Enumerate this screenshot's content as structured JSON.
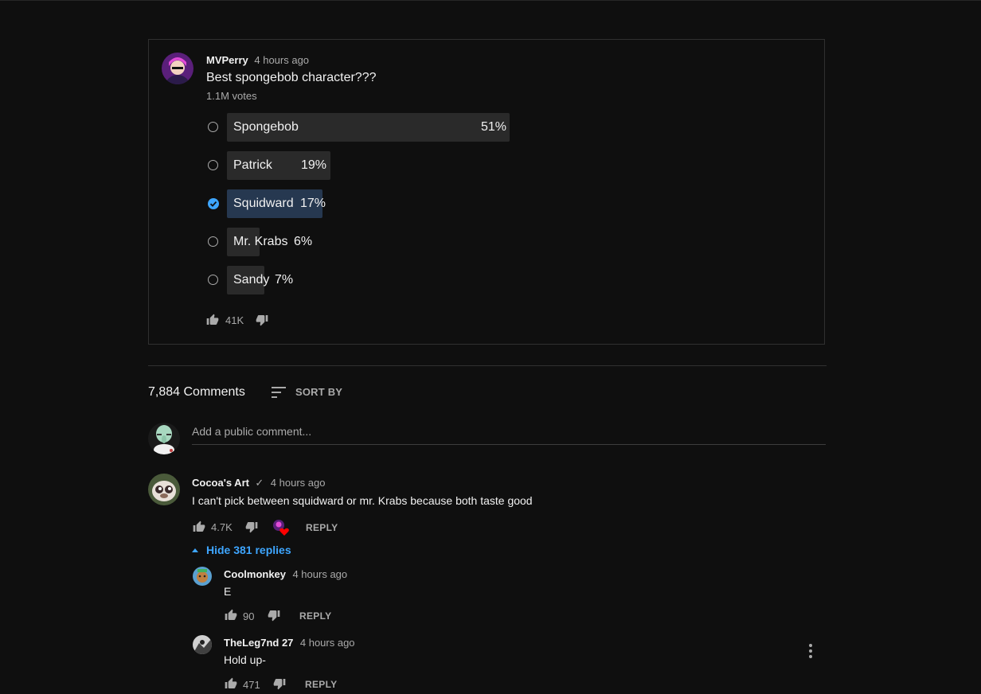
{
  "poll": {
    "author": "MVPerry",
    "time": "4 hours ago",
    "question": "Best spongebob character???",
    "votes": "1.1M votes",
    "options": [
      {
        "label": "Spongebob",
        "percent": "51%",
        "fraction": 0.51,
        "selected": false
      },
      {
        "label": "Patrick",
        "percent": "19%",
        "fraction": 0.19,
        "selected": false
      },
      {
        "label": "Squidward",
        "percent": "17%",
        "fraction": 0.17,
        "selected": true
      },
      {
        "label": "Mr. Krabs",
        "percent": "6%",
        "fraction": 0.06,
        "selected": false
      },
      {
        "label": "Sandy",
        "percent": "7%",
        "fraction": 0.07,
        "selected": false
      }
    ],
    "likes": "41K"
  },
  "comments_header": {
    "count": "7,884 Comments",
    "sort_label": "SORT BY"
  },
  "add_comment": {
    "placeholder": "Add a public comment..."
  },
  "comments": [
    {
      "author": "Cocoa's Art",
      "verified": "✓",
      "time": "4 hours ago",
      "text": "I can't pick between squidward or mr. Krabs because both taste good",
      "likes": "4.7K",
      "reply_label": "REPLY",
      "hide_replies": "Hide 381 replies"
    }
  ],
  "replies": [
    {
      "author": "Coolmonkey",
      "time": "4 hours ago",
      "text": "E",
      "likes": "90",
      "reply_label": "REPLY"
    },
    {
      "author": "TheLeg7nd 27",
      "time": "4 hours ago",
      "text": "Hold up-",
      "likes": "471",
      "reply_label": "REPLY"
    }
  ],
  "colors": {
    "background": "#0f0f0f",
    "accent": "#3ea6ff",
    "bar": "#2a2a2a",
    "bar_selected": "#263850",
    "heart": "#ff0000"
  }
}
